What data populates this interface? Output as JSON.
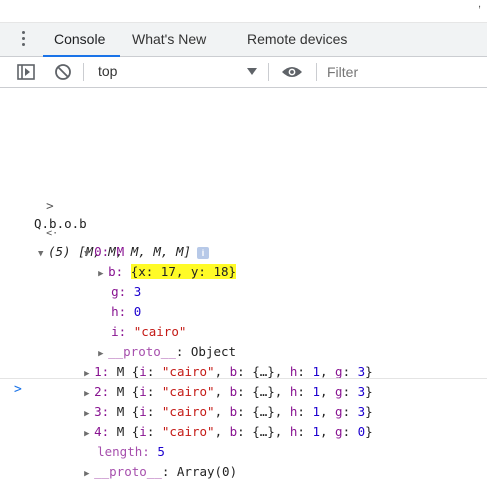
{
  "tabs": [
    "Console",
    "What's New",
    "Remote devices"
  ],
  "toolbar": {
    "context": "top",
    "filter_placeholder": "Filter"
  },
  "input_expr": "Q.b.o.b",
  "array_summary": {
    "count": "(5)",
    "preview": "[M, M, M, M, M]"
  },
  "item0": {
    "label": "0: M",
    "b_key": "b:",
    "b_val": "{x: 17, y: 18}",
    "g_key": "g:",
    "g_val": "3",
    "h_key": "h:",
    "h_val": "0",
    "i_key": "i:",
    "i_val": "\"cairo\"",
    "proto_key": "__proto__",
    "proto_val": ": Object"
  },
  "items": [
    {
      "idx": "1:",
      "type": "M",
      "i": "\"cairo\"",
      "h": "1",
      "g": "3"
    },
    {
      "idx": "2:",
      "type": "M",
      "i": "\"cairo\"",
      "h": "1",
      "g": "3"
    },
    {
      "idx": "3:",
      "type": "M",
      "i": "\"cairo\"",
      "h": "1",
      "g": "3"
    },
    {
      "idx": "4:",
      "type": "M",
      "i": "\"cairo\"",
      "h": "1",
      "g": "0"
    }
  ],
  "length": {
    "key": "length:",
    "val": "5"
  },
  "array_proto": {
    "key": "__proto__",
    "val": ": Array(0)"
  },
  "colors": {
    "accent": "#1a73e8",
    "highlight": "#fffb27",
    "key": "#881391",
    "string": "#c41a16",
    "number": "#1c00cf"
  },
  "icons": [
    "kebab-menu-icon",
    "dock-sidebar-icon",
    "clear-console-icon",
    "dropdown-arrow-icon",
    "eye-icon",
    "chevron-right-icon",
    "return-arrow-icon",
    "info-icon",
    "prompt-icon"
  ]
}
